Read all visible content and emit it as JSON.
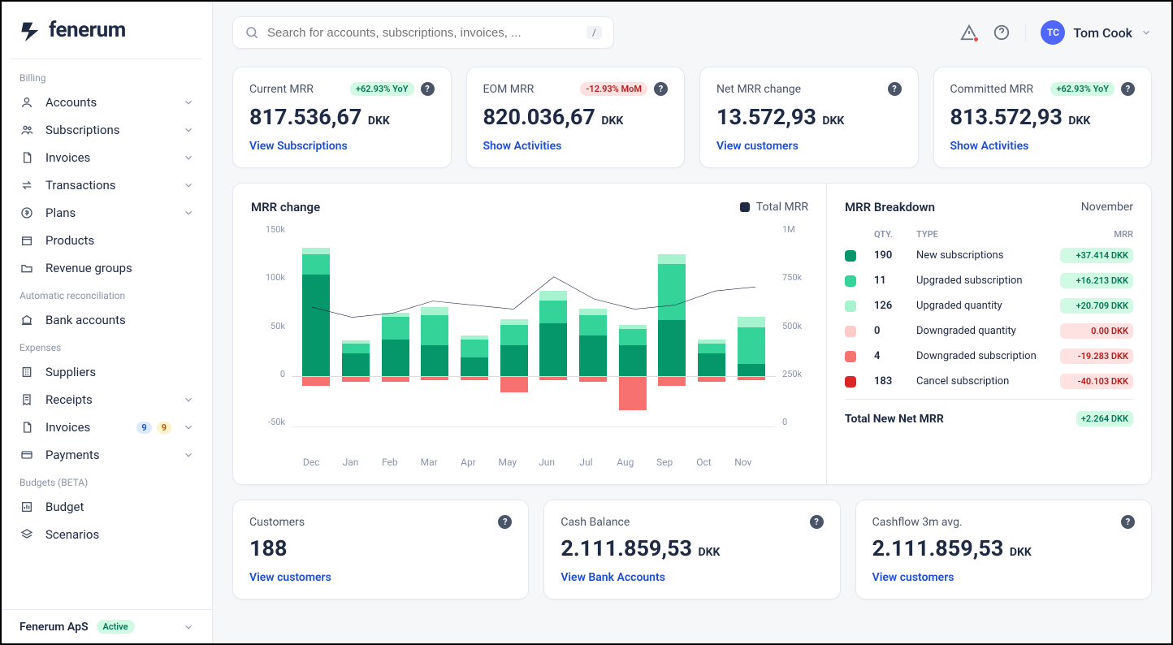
{
  "brand": {
    "name": "fenerum"
  },
  "search": {
    "placeholder": "Search for accounts, subscriptions, invoices, ...",
    "kbd": "/"
  },
  "user": {
    "initials": "TC",
    "name": "Tom Cook"
  },
  "sidebar": {
    "sections": {
      "billing": {
        "label": "Billing"
      },
      "recon": {
        "label": "Automatic reconciliation"
      },
      "expenses": {
        "label": "Expenses"
      },
      "budgets": {
        "label": "Budgets (BETA)"
      }
    },
    "items": {
      "accounts": "Accounts",
      "subscriptions": "Subscriptions",
      "invoices": "Invoices",
      "transactions": "Transactions",
      "plans": "Plans",
      "products": "Products",
      "revenue_groups": "Revenue groups",
      "bank_accounts": "Bank accounts",
      "suppliers": "Suppliers",
      "receipts": "Receipts",
      "exp_invoices": "Invoices",
      "payments": "Payments",
      "budget": "Budget",
      "scenarios": "Scenarios"
    },
    "exp_invoices_badges": {
      "blue": "9",
      "yellow": "9"
    },
    "footer": {
      "org": "Fenerum ApS",
      "status": "Active"
    }
  },
  "stats": [
    {
      "title": "Current MRR",
      "pill": "+62.93% YoY",
      "pill_type": "green",
      "value": "817.536,67",
      "currency": "DKK",
      "link": "View Subscriptions"
    },
    {
      "title": "EOM MRR",
      "pill": "-12.93% MoM",
      "pill_type": "red",
      "value": "820.036,67",
      "currency": "DKK",
      "link": "Show Activities"
    },
    {
      "title": "Net MRR change",
      "pill": "",
      "pill_type": "",
      "value": "13.572,93",
      "currency": "DKK",
      "link": "View customers"
    },
    {
      "title": "Committed MRR",
      "pill": "+62.93% YoY",
      "pill_type": "green",
      "value": "813.572,93",
      "currency": "DKK",
      "link": "Show Activities"
    }
  ],
  "chart": {
    "title": "MRR change",
    "legend": "Total MRR",
    "y_left": [
      "150k",
      "100k",
      "50k",
      "0",
      "-50k"
    ],
    "y_right": [
      "1M",
      "750k",
      "500k",
      "250k",
      "0"
    ],
    "x": [
      "Dec",
      "Jan",
      "Feb",
      "Mar",
      "Apr",
      "May",
      "Jun",
      "Jul",
      "Aug",
      "Sep",
      "Oct",
      "Nov"
    ]
  },
  "breakdown": {
    "title": "MRR Breakdown",
    "month": "November",
    "headers": {
      "qty": "QTY.",
      "type": "TYPE",
      "mrr": "MRR"
    },
    "rows": [
      {
        "color": "#059669",
        "qty": "190",
        "type": "New subscriptions",
        "mrr": "+37.414 DKK",
        "pos": true
      },
      {
        "color": "#34d399",
        "qty": "11",
        "type": "Upgraded subscription",
        "mrr": "+16.213 DKK",
        "pos": true
      },
      {
        "color": "#a7f3d0",
        "qty": "126",
        "type": "Upgraded quantity",
        "mrr": "+20.709 DKK",
        "pos": true
      },
      {
        "color": "#fecaca",
        "qty": "0",
        "type": "Downgraded quantity",
        "mrr": "0.00 DKK",
        "pos": false
      },
      {
        "color": "#f87171",
        "qty": "4",
        "type": "Downgraded subscription",
        "mrr": "-19.283 DKK",
        "pos": false
      },
      {
        "color": "#dc2626",
        "qty": "183",
        "type": "Cancel subscription",
        "mrr": "-40.103 DKK",
        "pos": false
      }
    ],
    "total": {
      "label": "Total New Net MRR",
      "mrr": "+2.264 DKK"
    }
  },
  "bottom": [
    {
      "title": "Customers",
      "value": "188",
      "currency": "",
      "link": "View customers"
    },
    {
      "title": "Cash Balance",
      "value": "2.111.859,53",
      "currency": "DKK",
      "link": "View Bank Accounts"
    },
    {
      "title": "Cashflow 3m avg.",
      "value": "2.111.859,53",
      "currency": "DKK",
      "link": "View customers"
    }
  ],
  "chart_data": {
    "type": "bar",
    "categories": [
      "Dec",
      "Jan",
      "Feb",
      "Mar",
      "Apr",
      "May",
      "Jun",
      "Jul",
      "Aug",
      "Sep",
      "Oct",
      "Nov"
    ],
    "series": [
      {
        "name": "New subscriptions",
        "color": "#059669",
        "values": [
          100,
          22,
          36,
          30,
          18,
          30,
          52,
          40,
          30,
          55,
          22,
          12
        ]
      },
      {
        "name": "Upgraded subscription",
        "color": "#34d399",
        "values": [
          20,
          10,
          22,
          30,
          18,
          20,
          22,
          20,
          16,
          55,
          10,
          36
        ]
      },
      {
        "name": "Upgraded quantity",
        "color": "#a7f3d0",
        "values": [
          6,
          3,
          4,
          8,
          4,
          6,
          10,
          6,
          4,
          10,
          4,
          10
        ]
      },
      {
        "name": "Downgraded quantity",
        "color": "#fecaca",
        "values": [
          0,
          0,
          0,
          0,
          0,
          0,
          0,
          0,
          0,
          0,
          0,
          0
        ]
      },
      {
        "name": "Downgraded subscription",
        "color": "#f87171",
        "values": [
          -10,
          -6,
          -6,
          -4,
          -4,
          -16,
          -4,
          -6,
          -34,
          -10,
          -6,
          -4
        ]
      },
      {
        "name": "Cancel subscription",
        "color": "#dc2626",
        "values": [
          0,
          0,
          0,
          0,
          0,
          0,
          0,
          0,
          0,
          0,
          0,
          0
        ]
      }
    ],
    "line": {
      "name": "Total MRR",
      "values": [
        590,
        540,
        560,
        620,
        600,
        580,
        740,
        630,
        580,
        600,
        670,
        690
      ],
      "y_axis": "right"
    },
    "y_left": {
      "min": -50,
      "max": 150,
      "unit": "k"
    },
    "y_right": {
      "min": 0,
      "max": 1000,
      "unit": "k"
    },
    "title": "MRR change"
  }
}
